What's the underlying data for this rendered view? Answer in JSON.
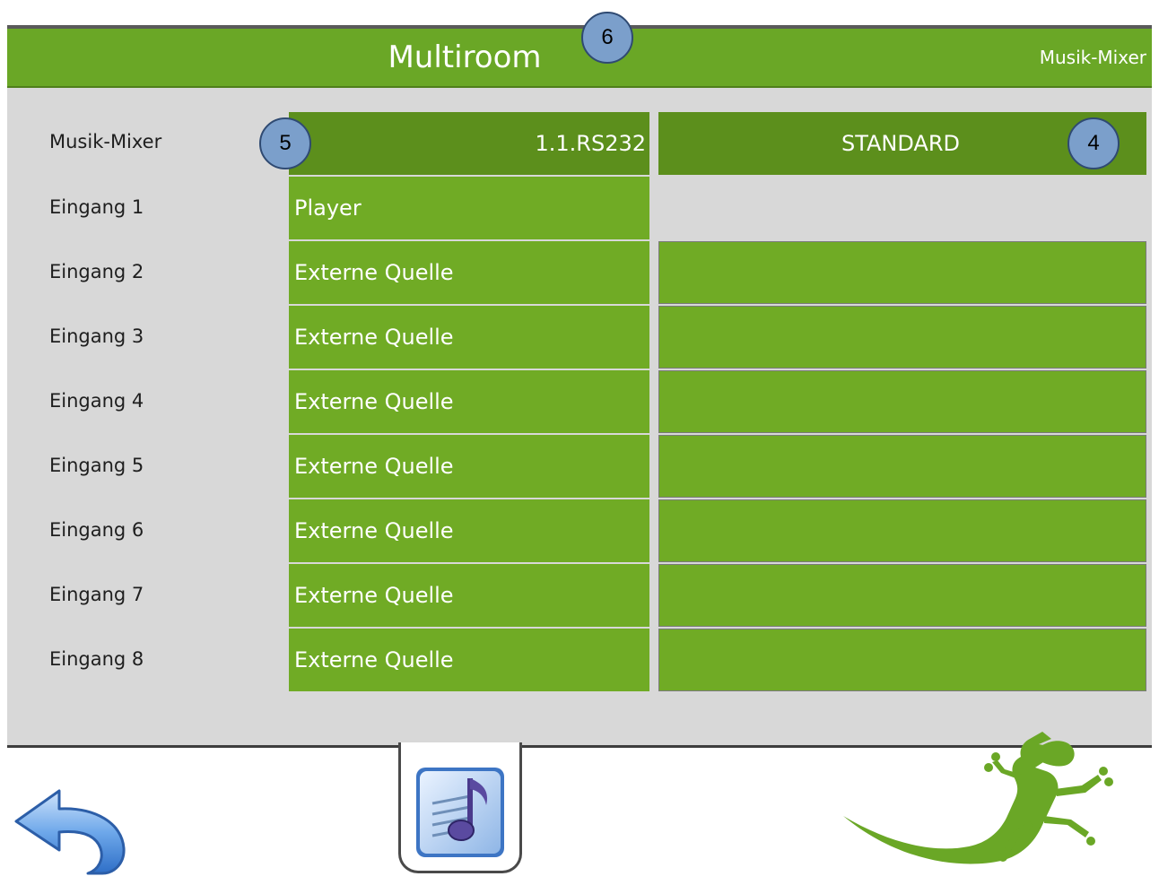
{
  "header": {
    "title": "Multiroom",
    "subtitle": "Musik-Mixer"
  },
  "callouts": [
    "6",
    "5",
    "4"
  ],
  "mixer_row": {
    "label": "Musik-Mixer",
    "interface": "1.1.RS232",
    "mode": "STANDARD"
  },
  "inputs": [
    {
      "label": "Eingang 1",
      "source": "Player"
    },
    {
      "label": "Eingang 2",
      "source": "Externe Quelle"
    },
    {
      "label": "Eingang 3",
      "source": "Externe Quelle"
    },
    {
      "label": "Eingang 4",
      "source": "Externe Quelle"
    },
    {
      "label": "Eingang 5",
      "source": "Externe Quelle"
    },
    {
      "label": "Eingang 6",
      "source": "Externe Quelle"
    },
    {
      "label": "Eingang 7",
      "source": "Externe Quelle"
    },
    {
      "label": "Eingang 8",
      "source": "Externe Quelle"
    }
  ],
  "icons": {
    "back": "back-arrow-icon",
    "music": "music-note-icon",
    "logo": "gecko-logo-icon"
  },
  "colors": {
    "header_green": "#6aa726",
    "cell_green": "#70ab25",
    "dark_green": "#5c8f1c",
    "panel_gray": "#d8d8d8",
    "callout_blue": "#7b9fcb"
  }
}
